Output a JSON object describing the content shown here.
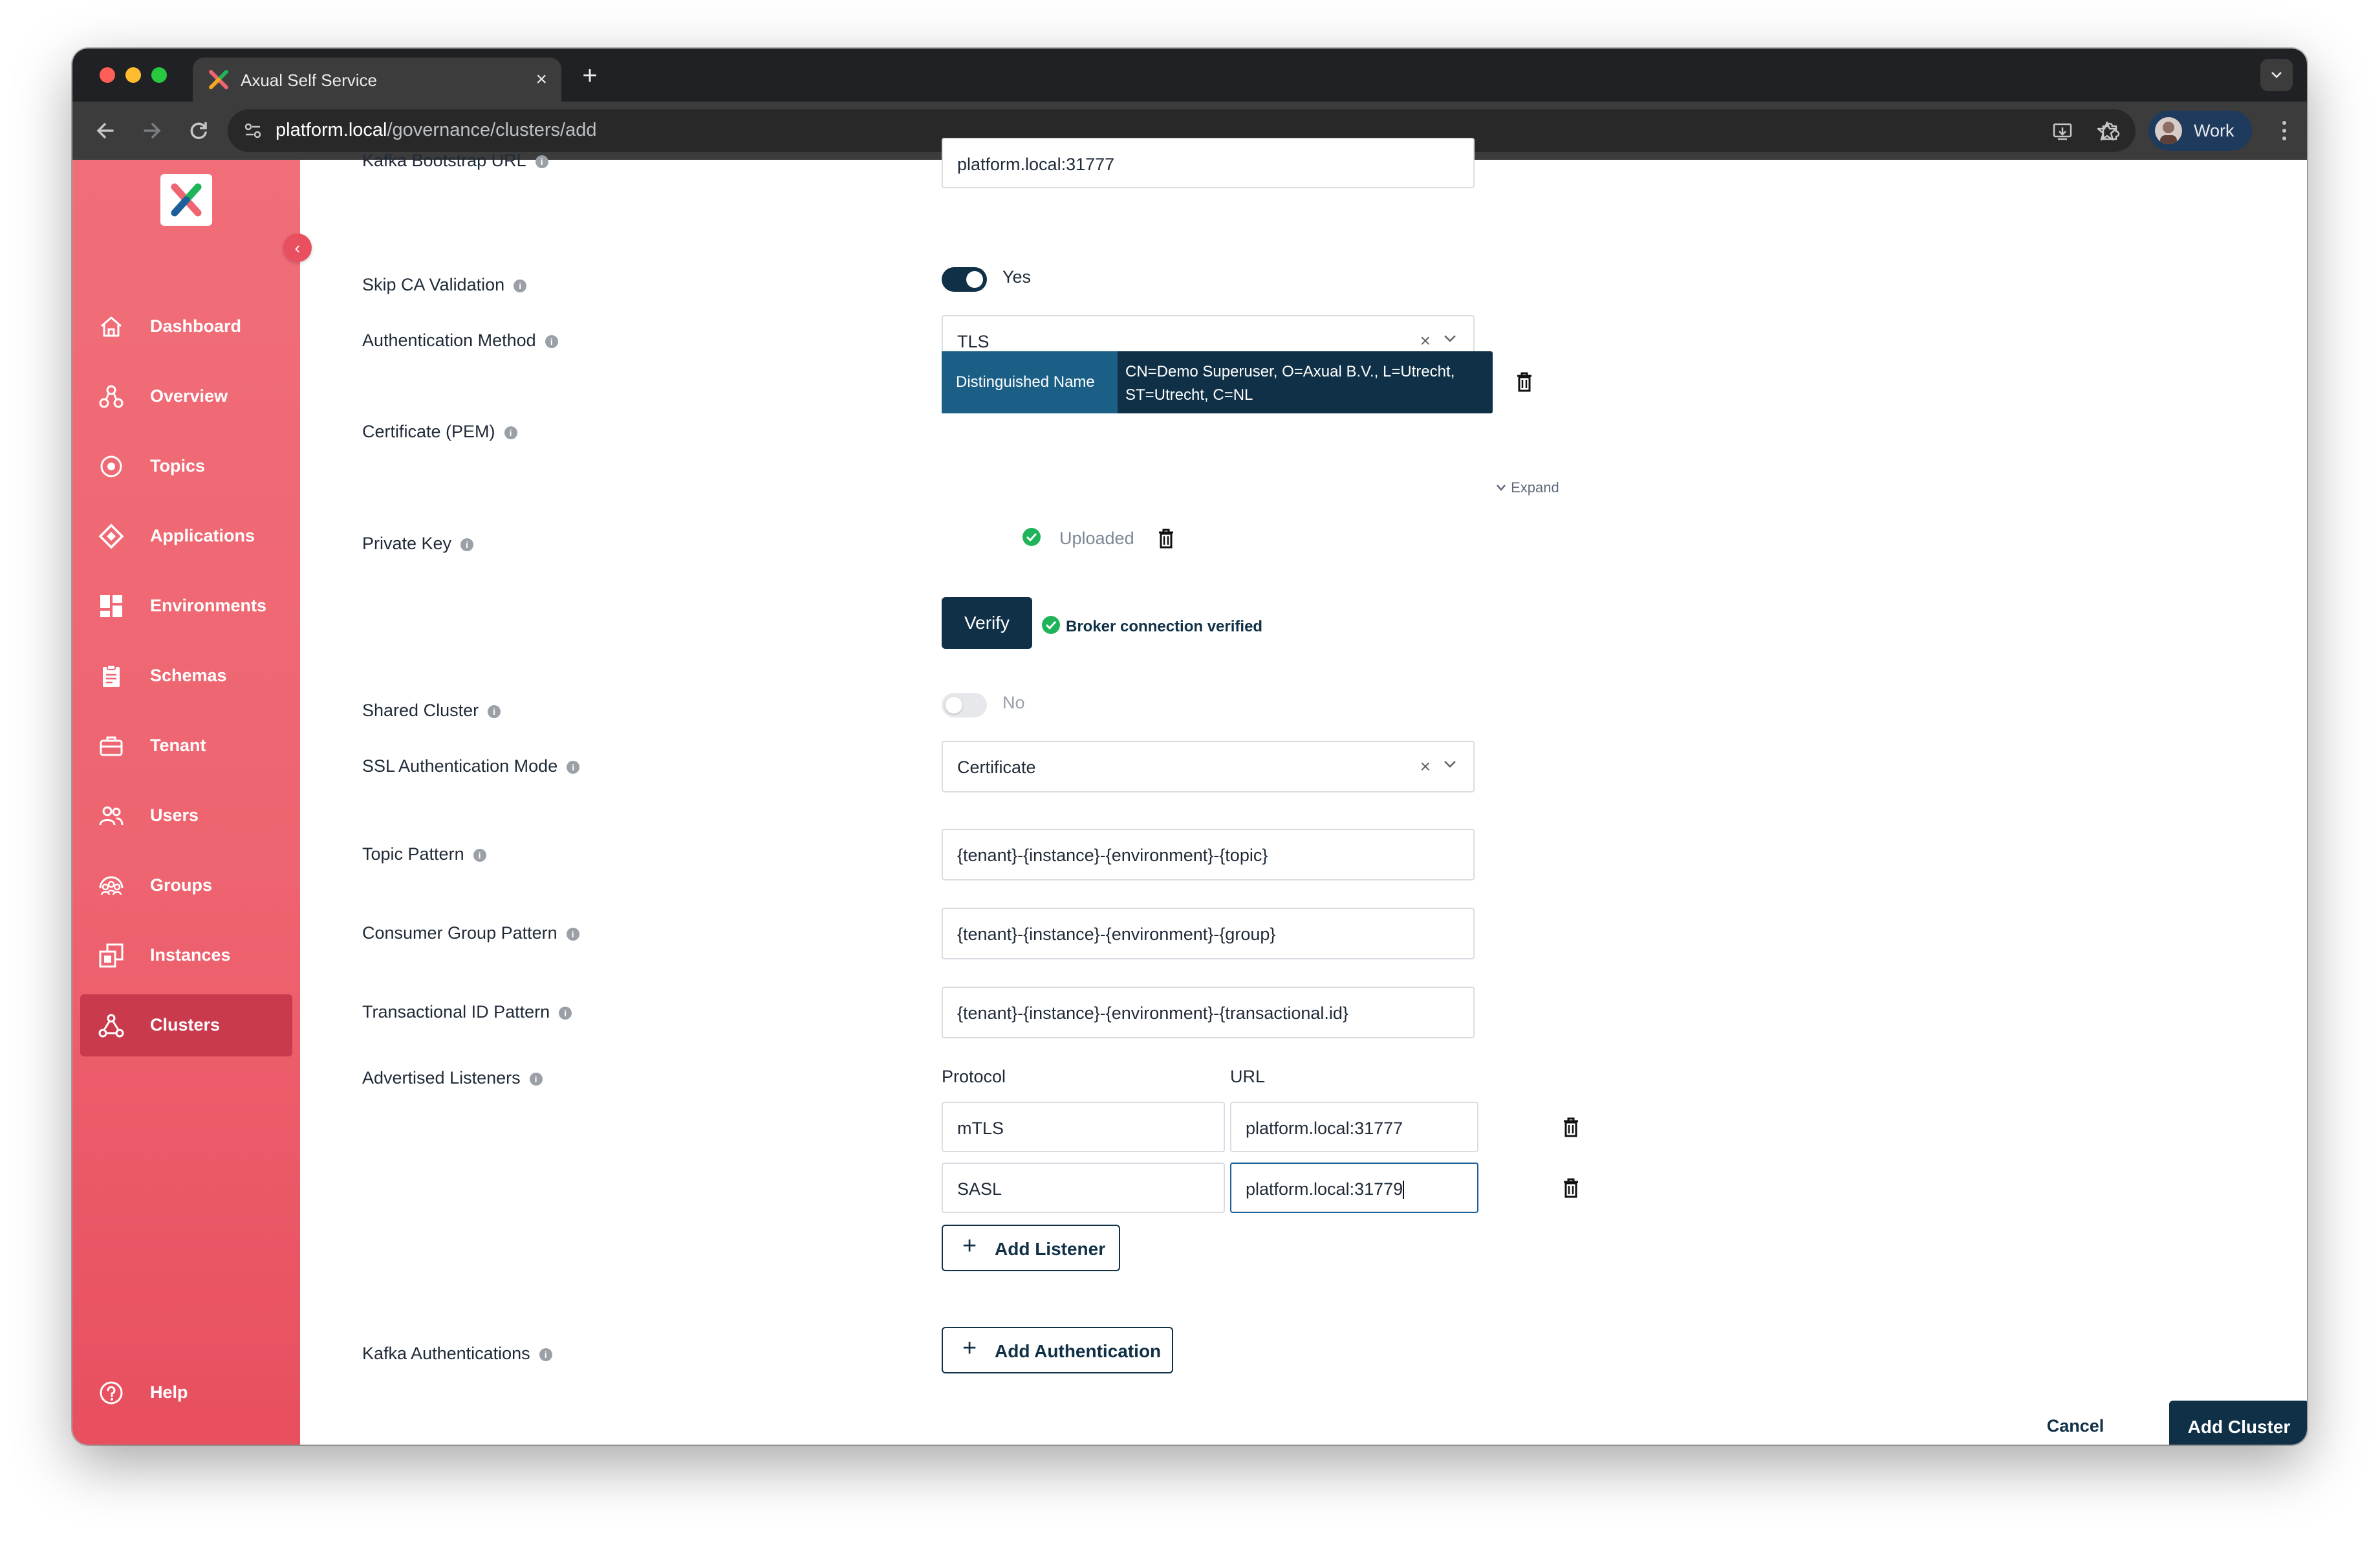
{
  "browser": {
    "tab_title": "Axual Self Service",
    "tab_close": "×",
    "new_tab": "+",
    "url_host": "platform.local",
    "url_path": "/governance/clusters/add",
    "profile_label": "Work"
  },
  "sidebar": {
    "collapse": "‹",
    "items": [
      {
        "label": "Dashboard",
        "icon": "home-icon"
      },
      {
        "label": "Overview",
        "icon": "overview-icon"
      },
      {
        "label": "Topics",
        "icon": "topics-icon"
      },
      {
        "label": "Applications",
        "icon": "applications-icon"
      },
      {
        "label": "Environments",
        "icon": "environments-icon"
      },
      {
        "label": "Schemas",
        "icon": "schemas-icon"
      },
      {
        "label": "Tenant",
        "icon": "tenant-icon"
      },
      {
        "label": "Users",
        "icon": "users-icon"
      },
      {
        "label": "Groups",
        "icon": "groups-icon"
      },
      {
        "label": "Instances",
        "icon": "instances-icon"
      },
      {
        "label": "Clusters",
        "icon": "clusters-icon",
        "active": true
      }
    ],
    "help": "Help"
  },
  "form": {
    "bootstrap_label": "Kafka Bootstrap URL",
    "bootstrap_value": "platform.local:31777",
    "skip_ca_label": "Skip CA Validation",
    "skip_ca_value": "Yes",
    "auth_method_label": "Authentication Method",
    "auth_method_value": "TLS",
    "clear": "×",
    "certificate_label": "Certificate (PEM)",
    "cert_key": "Distinguished Name",
    "cert_value": "CN=Demo Superuser, O=Axual B.V., L=Utrecht, ST=Utrecht, C=NL",
    "expand": "Expand",
    "private_key_label": "Private Key",
    "private_key_status": "Uploaded",
    "verify_button": "Verify",
    "verify_status": "Broker connection verified",
    "shared_cluster_label": "Shared Cluster",
    "shared_cluster_value": "No",
    "ssl_mode_label": "SSL Authentication Mode",
    "ssl_mode_value": "Certificate",
    "topic_pattern_label": "Topic Pattern",
    "topic_pattern_value": "{tenant}-{instance}-{environment}-{topic}",
    "consumer_group_label": "Consumer Group Pattern",
    "consumer_group_value": "{tenant}-{instance}-{environment}-{group}",
    "transactional_label": "Transactional ID Pattern",
    "transactional_value": "{tenant}-{instance}-{environment}-{transactional.id}",
    "listeners_label": "Advertised Listeners",
    "protocol_header": "Protocol",
    "url_header": "URL",
    "listeners": [
      {
        "protocol": "mTLS",
        "url": "platform.local:31777"
      },
      {
        "protocol": "SASL",
        "url": "platform.local:31779"
      }
    ],
    "add_listener": "Add Listener",
    "kafka_auth_label": "Kafka Authentications",
    "add_authentication": "Add Authentication",
    "plus": "+",
    "info": "i"
  },
  "footer": {
    "cancel": "Cancel",
    "submit": "Add Cluster"
  },
  "colors": {
    "brand_navy": "#0f3046",
    "sidebar_red": "#ee6470",
    "success_green": "#1fb45a"
  }
}
